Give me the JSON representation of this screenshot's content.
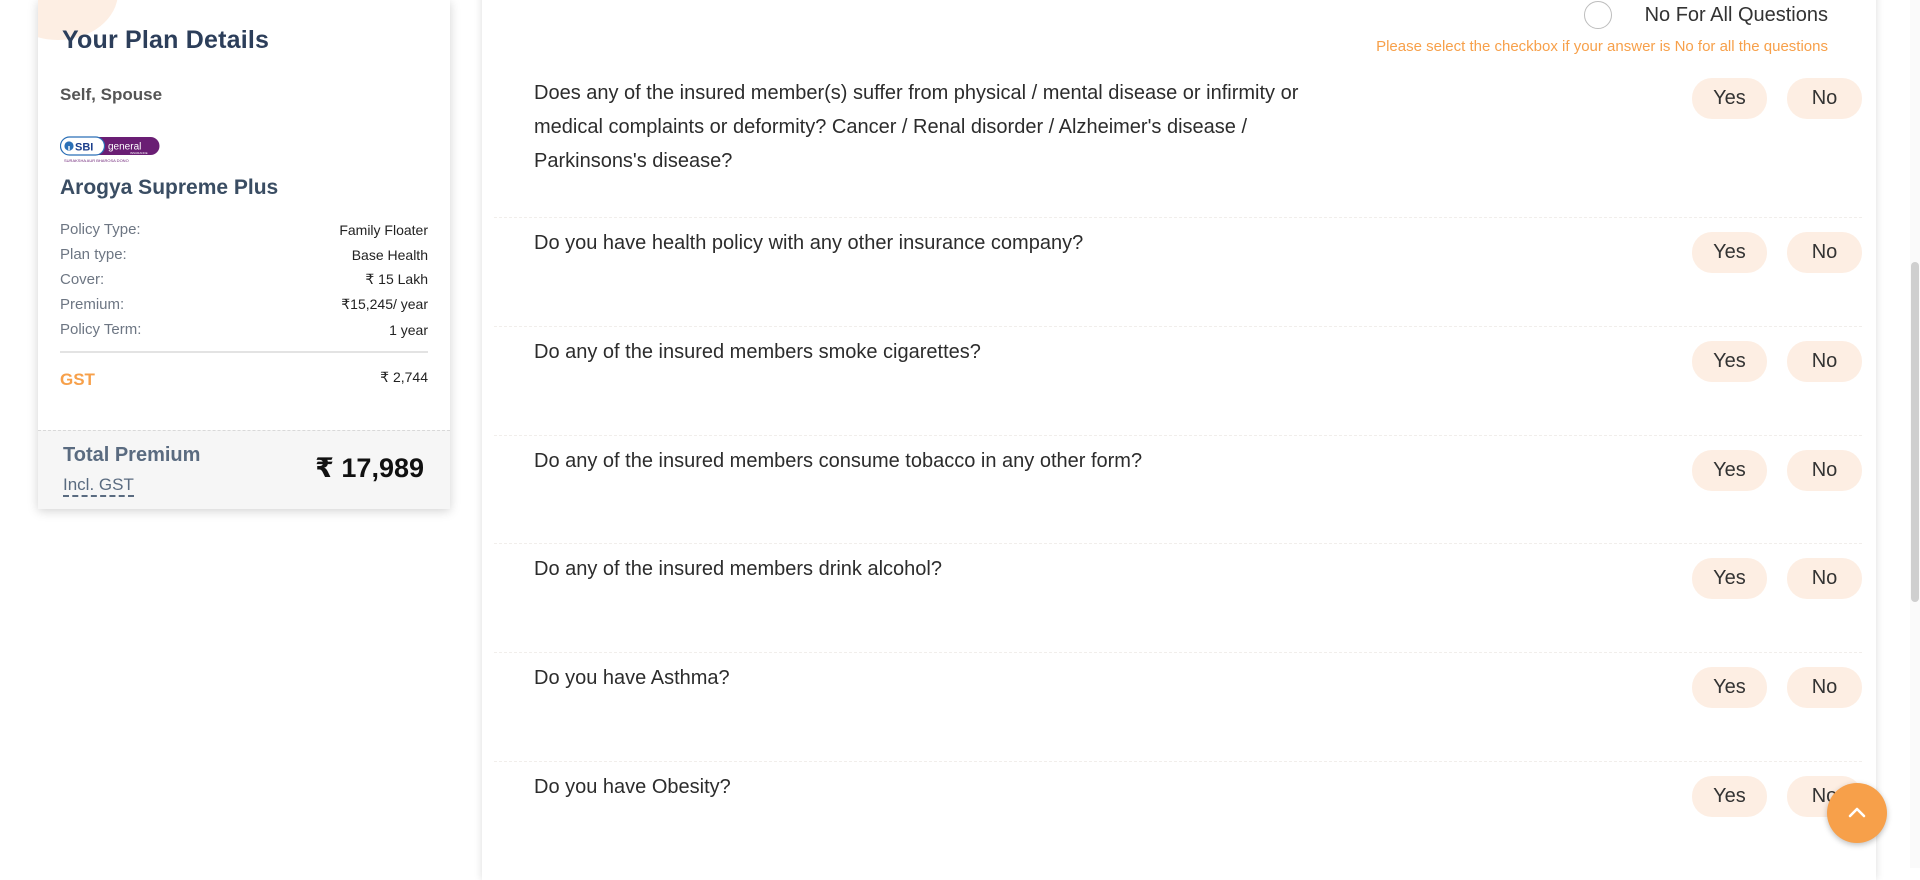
{
  "plan": {
    "title": "Your Plan Details",
    "members": "Self, Spouse",
    "insurer_logo": {
      "brand": "SBI",
      "word": "general",
      "sub": "INSURANCE",
      "tagline": "SURAKSHA AUR BHAROSA DONO"
    },
    "plan_name": "Arogya Supreme Plus",
    "details": [
      {
        "label": "Policy Type:",
        "value": "Family Floater"
      },
      {
        "label": "Plan type:",
        "value": "Base Health"
      },
      {
        "label": "Cover:",
        "value": "₹ 15 Lakh"
      },
      {
        "label": "Premium:",
        "value": "₹15,245/ year"
      },
      {
        "label": "Policy Term:",
        "value": "1 year"
      }
    ],
    "gst_label": "GST",
    "gst_value": "₹ 2,744",
    "total_label": "Total Premium",
    "incl_gst": "Incl. GST",
    "total_value": "₹ 17,989"
  },
  "no_for_all": {
    "label": "No For All Questions",
    "hint": "Please select the checkbox if your answer is No for all the questions"
  },
  "questions": [
    {
      "text": "Does any of the insured member(s) suffer from physical / mental disease or infirmity or medical complaints or deformity? Cancer / Renal disorder / Alzheimer's disease / Parkinsons's disease?",
      "yes": "Yes",
      "no": "No"
    },
    {
      "text": "Do you have health policy with any other insurance company?",
      "yes": "Yes",
      "no": "No"
    },
    {
      "text": "Do any of the insured members smoke cigarettes?",
      "yes": "Yes",
      "no": "No"
    },
    {
      "text": "Do any of the insured members consume tobacco in any other form?",
      "yes": "Yes",
      "no": "No"
    },
    {
      "text": "Do any of the insured members drink alcohol?",
      "yes": "Yes",
      "no": "No"
    },
    {
      "text": "Do you have Asthma?",
      "yes": "Yes",
      "no": "No"
    },
    {
      "text": "Do you have Obesity?",
      "yes": "Yes",
      "no": "No"
    }
  ],
  "icons": {
    "scroll_top": "chevron-up-icon",
    "accent_color": "#f7a04a",
    "button_bg": "#fdeee3"
  }
}
